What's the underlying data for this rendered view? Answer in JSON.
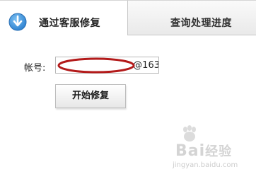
{
  "tabs": [
    {
      "label": "通过客服修复",
      "active": true
    },
    {
      "label": "查询处理进度",
      "active": false
    }
  ],
  "form": {
    "account_label": "帐号:",
    "account_value_visible": "@163",
    "start_button_label": "开始修复"
  },
  "icons": {
    "active_tab_icon": "arrow-down-circle-icon",
    "redaction_mark": "red-ellipse-annotation"
  },
  "colors": {
    "tab_icon_blue": "#3b8fd6",
    "redaction_red": "#b31a1a",
    "watermark_gray": "#d4d4d4"
  },
  "watermark": {
    "brand_text": "Bai",
    "brand_suffix": "经验",
    "url_text": "jingyan.baidu.com"
  }
}
